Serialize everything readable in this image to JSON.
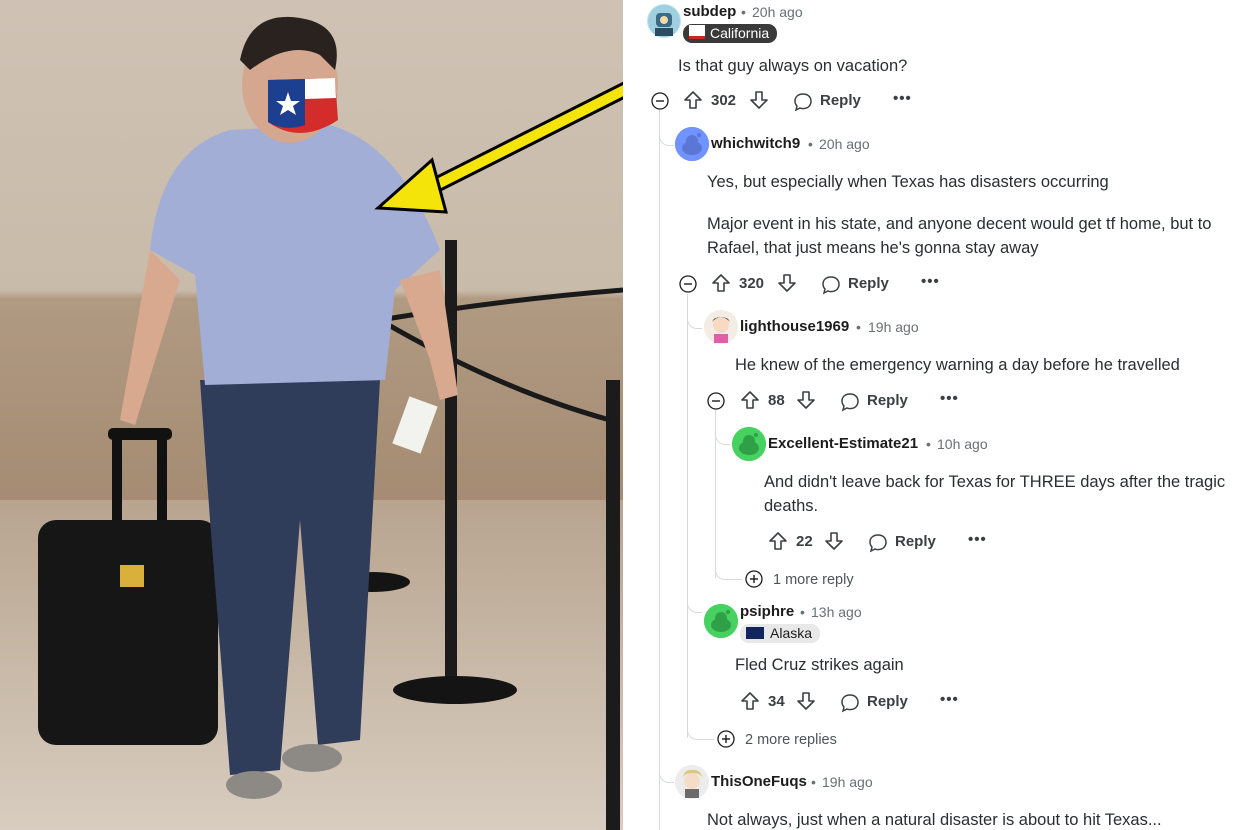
{
  "comments": [
    {
      "user": "subdep",
      "time": "20h ago",
      "flair": "California",
      "body": "Is that guy always on vacation?",
      "votes": "302",
      "reply": "Reply"
    },
    {
      "user": "whichwitch9",
      "time": "20h ago",
      "body1": "Yes, but especially when Texas has disasters occurring",
      "body2": "Major event in his state, and anyone decent would get tf home, but to",
      "body3": "Rafael, that just means he's gonna stay away",
      "votes": "320",
      "reply": "Reply"
    },
    {
      "user": "lighthouse1969",
      "time": "19h ago",
      "body": "He knew of the emergency warning a day before he travelled",
      "votes": "88",
      "reply": "Reply"
    },
    {
      "user": "Excellent-Estimate21",
      "time": "10h ago",
      "body1": "And didn't leave back for Texas for THREE days after the tragic",
      "body2": "deaths.",
      "votes": "22",
      "reply": "Reply"
    },
    {
      "user": "psiphre",
      "time": "13h ago",
      "flair": "Alaska",
      "body": "Fled Cruz strikes again",
      "votes": "34",
      "reply": "Reply"
    },
    {
      "user": "ThisOneFuqs",
      "time": "19h ago",
      "body": "Not always, just when a natural disaster is about to hit Texas..."
    }
  ],
  "more_replies": [
    "1 more reply",
    "2 more replies"
  ],
  "separator": "•",
  "more_glyph": "•••",
  "colors": {
    "arrow": "#f4e409",
    "mask_red": "#d42b2b",
    "mask_blue": "#1d3f8f",
    "avatar_green": "#46d160",
    "avatar_blue": "#7193ff"
  }
}
